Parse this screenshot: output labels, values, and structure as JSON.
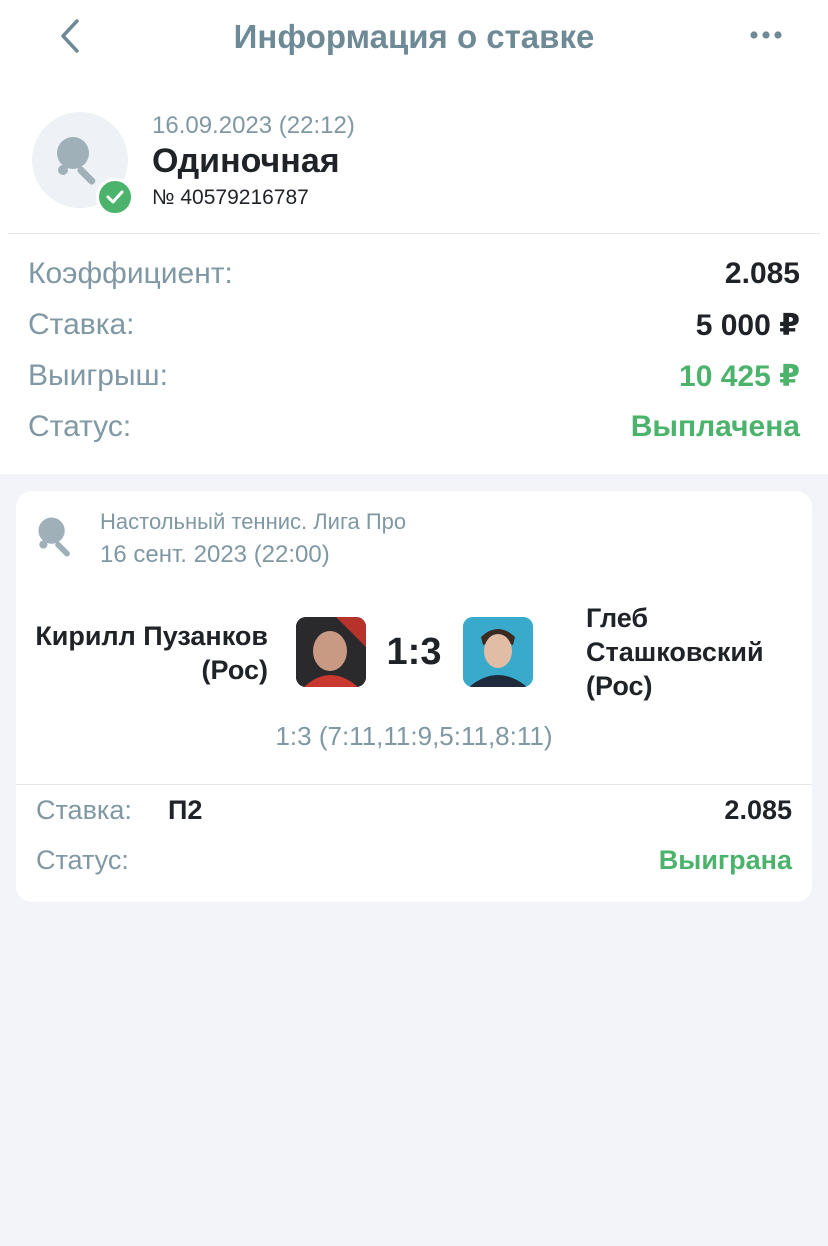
{
  "header": {
    "title": "Информация о ставке",
    "back_icon": "chevron-left-icon",
    "more_icon": "more-dots-icon"
  },
  "bet": {
    "date": "16.09.2023 (22:12)",
    "type": "Одиночная",
    "number": "№ 40579216787",
    "status_icon": "check-icon"
  },
  "summary": {
    "odds_label": "Коэффициент:",
    "odds_value": "2.085",
    "stake_label": "Ставка:",
    "stake_value": "5 000 ₽",
    "win_label": "Выигрыш:",
    "win_value": "10 425 ₽",
    "status_label": "Статус:",
    "status_value": "Выплачена"
  },
  "event": {
    "sport_icon": "table-tennis-icon",
    "league": "Настольный теннис. Лига Про",
    "date": "16 сент. 2023 (22:00)",
    "team1": "Кирилл Пузанков (Рос)",
    "team2": "Глеб Сташковский (Рос)",
    "score": "1:3",
    "score_detail": "1:3 (7:11,11:9,5:11,8:11)",
    "bet_label": "Ставка:",
    "bet_pick": "П2",
    "bet_odds": "2.085",
    "status_label": "Статус:",
    "status_value": "Выиграна"
  },
  "colors": {
    "accent_green": "#4bb36b",
    "muted_text": "#7f98a3",
    "header_text": "#6f8a97",
    "background": "#f2f4f9"
  }
}
